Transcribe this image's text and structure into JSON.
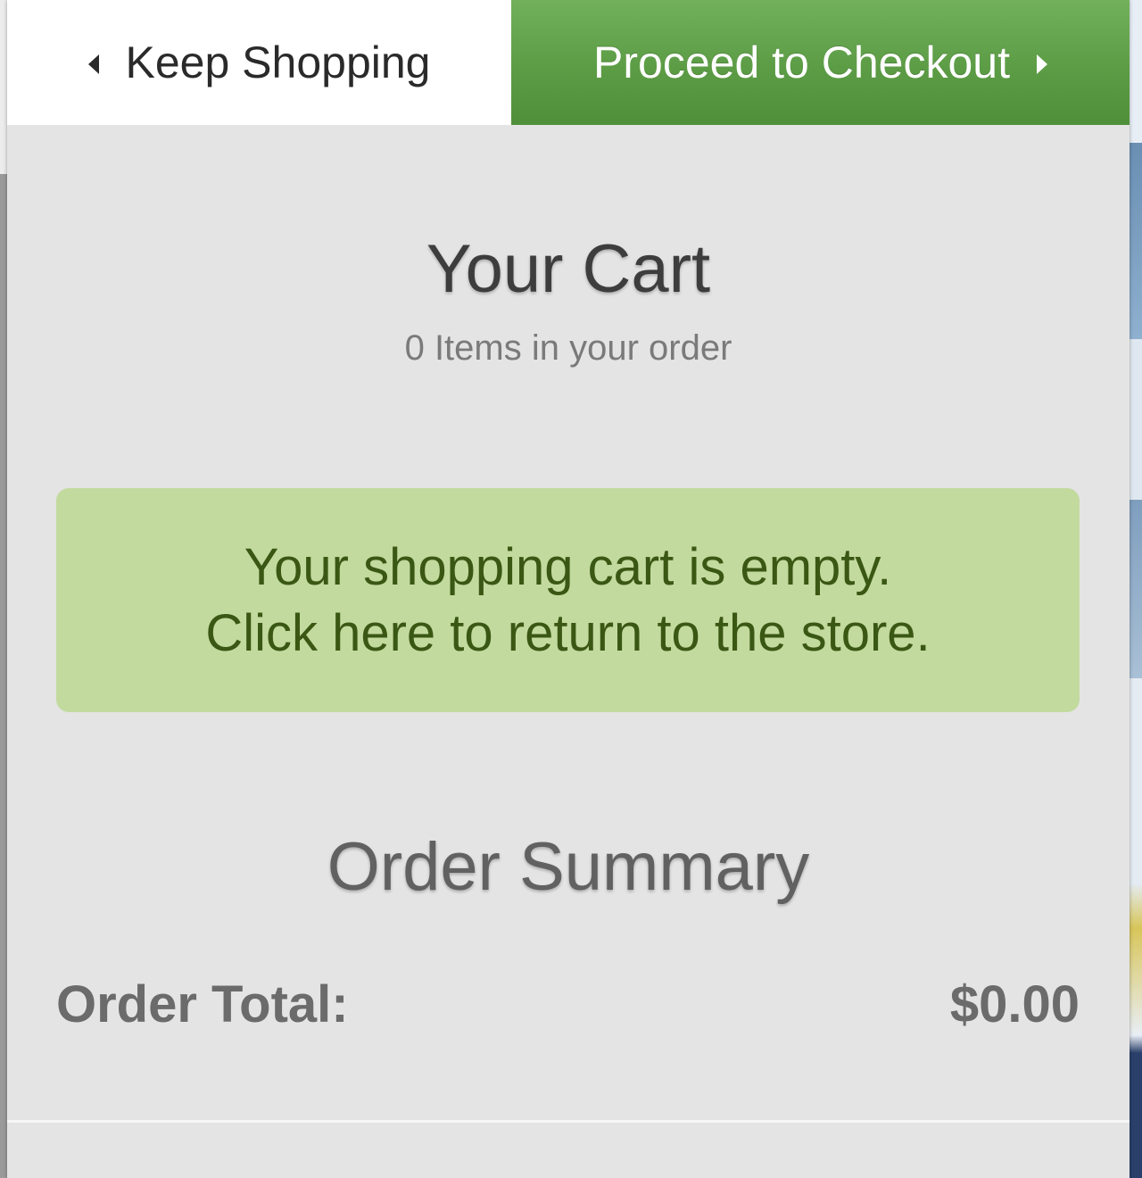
{
  "topbar": {
    "keep_shopping_label": "Keep Shopping",
    "checkout_label": "Proceed to Checkout",
    "checkout_color": "#5c9c45"
  },
  "cart": {
    "title": "Your Cart",
    "item_count_text": "0 Items in your order"
  },
  "empty_message": {
    "line1": "Your shopping cart is empty.",
    "line2": "Click here to return to the store.",
    "background_color": "#c3da9e",
    "text_color": "#3a5714"
  },
  "summary": {
    "title": "Order Summary",
    "total_label": "Order Total:",
    "total_value": "$0.00"
  }
}
